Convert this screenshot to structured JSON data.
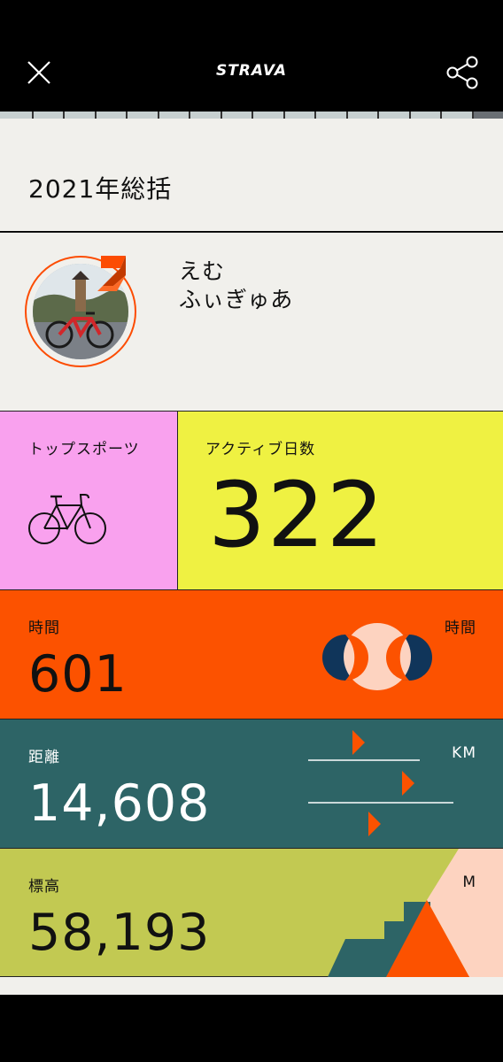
{
  "header": {
    "brand": "STRAVA",
    "close_icon": "close-icon",
    "share_icon": "share-icon"
  },
  "story": {
    "total_segments": 16,
    "current_segment": 16
  },
  "summary": {
    "title": "2021年総括"
  },
  "profile": {
    "name_line1": "えむ",
    "name_line2": "ふぃぎゅあ",
    "avatar_icon": "avatar-photo"
  },
  "top_sport": {
    "label": "トップスポーツ",
    "icon": "bicycle-icon"
  },
  "active_days": {
    "label": "アクティブ日数",
    "value": "322"
  },
  "time": {
    "label": "時間",
    "value": "601",
    "unit": "時間"
  },
  "distance": {
    "label": "距離",
    "value": "14,608",
    "unit": "KM"
  },
  "elevation": {
    "label": "標高",
    "value": "58,193",
    "unit": "M"
  },
  "colors": {
    "accent": "#fc4c02",
    "pink": "#f9a1ee",
    "yellow": "#eff142",
    "orange": "#fc5200",
    "teal": "#2d6466",
    "olive": "#c2c952",
    "navy": "#10355a",
    "peach": "#fdd3c0",
    "paper": "#f1f0ec"
  }
}
